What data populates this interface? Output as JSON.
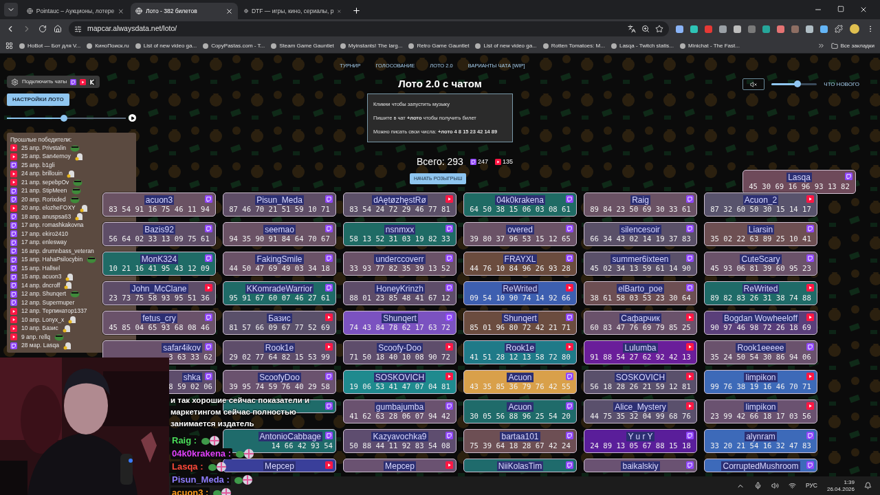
{
  "browser": {
    "tabs": [
      {
        "title": "Pointauc – Аукционы, лотере",
        "selected": false
      },
      {
        "title": "Лото - 382 билетов",
        "selected": true
      },
      {
        "title": "DTF — игры, кино, сериалы, р",
        "selected": false
      }
    ],
    "address": "mapcar.alwaysdata.net/loto/",
    "bookmarks": [
      "HoBot — Бот для V...",
      "КиноПоиск.ru",
      "List of new video ga...",
      "CopyPastas.com - T...",
      "Steam Game Gauntlet",
      "Myinstants! The larg...",
      "Retro Game Gauntlet",
      "List of new video ga...",
      "Rotten Tomatoes: M...",
      "Lasqa - Twitch statis...",
      "Minichat - The Fast..."
    ],
    "all_bookmarks": "Все закладки"
  },
  "nav": [
    "ТУРНИР",
    "ГОЛОСОВАНИЕ",
    "ЛОТО 2.0",
    "ВАРИАНТЫ ЧАТА [WIP]"
  ],
  "title": "Лото 2.0 с чатом",
  "connect_chats": "Подключить чаты",
  "settings_button": "НАСТРОЙКИ ЛОТО",
  "music_slider": {
    "level": 0.48
  },
  "volume": {
    "level": 0.57
  },
  "whats_new": "ЧТО НОВОГО",
  "info": [
    "Кликни чтобы запустить музыку",
    "Пишите в чат **+лото** чтобы получить билет",
    "Можно писать свои числа: **+лото 4 8 15 23 42 14 89**"
  ],
  "total": {
    "label": "Всего: 293",
    "twitch": "247",
    "youtube": "135"
  },
  "start_button": "НАЧАТЬ РОЗЫГРЫШ",
  "winners": {
    "title": "Прошлые победители:",
    "items": [
      {
        "text": "25 апр. Privstalin",
        "kind": "youtube",
        "emotes": [
          {
            "kind": "frog"
          }
        ]
      },
      {
        "text": "25 апр. San4ernoy",
        "kind": "youtube",
        "emotes": [
          {
            "kind": "ghost"
          }
        ]
      },
      {
        "text": "25 апр. b1gli",
        "kind": "twitch"
      },
      {
        "text": "24 апр. brillouin",
        "kind": "youtube",
        "emotes": [
          {
            "kind": "ghost"
          }
        ]
      },
      {
        "text": "21 апр. sepebpOv",
        "kind": "youtube",
        "emotes": [
          {
            "kind": "frog"
          }
        ]
      },
      {
        "text": "21 апр. StipMeen",
        "kind": "twitch",
        "emotes": [
          {
            "kind": "frog"
          }
        ]
      },
      {
        "text": "20 апр. Rorixded",
        "kind": "twitch",
        "emotes": [
          {
            "kind": "frog"
          }
        ]
      },
      {
        "text": "20 апр. elozheFOXY",
        "kind": "youtube",
        "emotes": [
          {
            "kind": "ghost"
          }
        ]
      },
      {
        "text": "18 апр. anuspsa63",
        "kind": "twitch",
        "emotes": [
          {
            "kind": "ghost"
          }
        ]
      },
      {
        "text": "17 апр. romashkakovna",
        "kind": "twitch"
      },
      {
        "text": "17 апр. ekiro2410",
        "kind": "twitch"
      },
      {
        "text": "17 апр. enlesway",
        "kind": "twitch"
      },
      {
        "text": "16 апр. drumnbass_veteran",
        "kind": "twitch"
      },
      {
        "text": "15 апр. HahaPsilocybin",
        "kind": "twitch",
        "emotes": [
          {
            "kind": "frog"
          }
        ]
      },
      {
        "text": "15 апр. Hallsel",
        "kind": "twitch"
      },
      {
        "text": "15 апр. acuon3",
        "kind": "twitch",
        "emotes": [
          {
            "kind": "ghost"
          }
        ]
      },
      {
        "text": "14 апр. dncroff",
        "kind": "twitch",
        "emotes": [
          {
            "kind": "ghost"
          }
        ]
      },
      {
        "text": "12 апр. Shunqert",
        "kind": "twitch",
        "emotes": [
          {
            "kind": "frog"
          }
        ]
      },
      {
        "text": "12 апр. Supermuper",
        "kind": "twitch"
      },
      {
        "text": "12 апр. Терпинатор1337",
        "kind": "youtube"
      },
      {
        "text": "10 апр. Lonyx_x",
        "kind": "youtube",
        "emotes": [
          {
            "kind": "ghost"
          }
        ]
      },
      {
        "text": "10 апр. Базис",
        "kind": "youtube",
        "emotes": [
          {
            "kind": "ghost"
          }
        ]
      },
      {
        "text": "9 апр. rellq",
        "kind": "youtube",
        "emotes": [
          {
            "kind": "frog"
          }
        ]
      },
      {
        "text": "28 мар. Lasqa",
        "kind": "twitch",
        "emotes": [
          {
            "kind": "ghost"
          }
        ]
      }
    ]
  },
  "floating_ticket": {
    "name": "Lasqa",
    "numbers": "45 30 69 16 96 93 13 82",
    "kind": "twitch",
    "color": "#6e4a5a"
  },
  "tickets": [
    [
      {
        "name": "acuon3",
        "numbers": "83 54 91 16 75 46 11 94",
        "kind": "twitch",
        "color": "#6a5263"
      },
      {
        "name": "Pisun_Meda",
        "numbers": "87 46 70 21 51 59 10 71",
        "kind": "twitch",
        "color": "#5e4d66"
      },
      {
        "name": "dAętøzhęstRø",
        "numbers": "83 54 24 72 29 46 77 81",
        "kind": "youtube",
        "color": "#5c5068"
      },
      {
        "name": "04k0krakena",
        "numbers": "64 50 38 15 06 03 08 61",
        "kind": "twitch",
        "color": "#1f6b64"
      },
      {
        "name": "Raig",
        "numbers": "89 84 23 50 69 30 33 61",
        "kind": "twitch",
        "color": "#6a5264"
      },
      {
        "name": "Acuon_2",
        "numbers": "87 32 60 50 30 15 14 17",
        "kind": "youtube",
        "color": "#58536c"
      }
    ],
    [
      {
        "name": "Bazis92",
        "numbers": "56 64 02 33 13 09 75 61",
        "kind": "twitch",
        "color": "#5e4d67"
      },
      {
        "name": "seemao",
        "numbers": "94 35 90 91 84 64 70 67",
        "kind": "twitch",
        "color": "#6a5265"
      },
      {
        "name": "nsnmxx",
        "numbers": "58 13 52 31 03 19 82 33",
        "kind": "twitch",
        "color": "#1f6b65"
      },
      {
        "name": "overed",
        "numbers": "39 80 37 96 53 15 12 65",
        "kind": "twitch",
        "color": "#6a5266"
      },
      {
        "name": "silencesoir",
        "numbers": "66 34 43 02 14 19 37 83",
        "kind": "twitch",
        "color": "#5a5068"
      },
      {
        "name": "Liarsin",
        "numbers": "35 02 22 63 89 25 10 41",
        "kind": "twitch",
        "color": "#6d4f52"
      }
    ],
    [
      {
        "name": "MonK324",
        "numbers": "10 21 16 41 95 43 12 09",
        "kind": "twitch",
        "color": "#1f6b66"
      },
      {
        "name": "FakingSmile",
        "numbers": "44 50 47 69 49 03 34 18",
        "kind": "twitch",
        "color": "#6a5267"
      },
      {
        "name": "underccoverr",
        "numbers": "33 93 77 82 35 39 13 52",
        "kind": "twitch",
        "color": "#6a5268"
      },
      {
        "name": "FRAYXL",
        "numbers": "44 76 10 84 96 26 93 28",
        "kind": "twitch",
        "color": "#6b4c3e"
      },
      {
        "name": "summer6ixteen",
        "numbers": "45 02 34 13 59 61 14 90",
        "kind": "twitch",
        "color": "#5a5069"
      },
      {
        "name": "CuteScary",
        "numbers": "45 93 06 81 39 60 95 23",
        "kind": "twitch",
        "color": "#6a5269"
      }
    ],
    [
      {
        "name": "John_McClane",
        "numbers": "23 73 75 58 93 95 51 36",
        "kind": "youtube",
        "color": "#5e4d68"
      },
      {
        "name": "KKomradeWarrior",
        "numbers": "95 91 67 60 07 46 27 61",
        "kind": "twitch",
        "color": "#1f6b67"
      },
      {
        "name": "HoneyKrinzh",
        "numbers": "88 01 23 85 48 41 67 12",
        "kind": "twitch",
        "color": "#5e4d69"
      },
      {
        "name": "ReWrited",
        "numbers": "09 54 10 90 74 14 92 66",
        "kind": "youtube",
        "color": "#3d5fb0"
      },
      {
        "name": "elBarto_poe",
        "numbers": "38 61 58 03 53 23 30 64",
        "kind": "twitch",
        "color": "#6d4f53"
      },
      {
        "name": "ReWrited",
        "numbers": "89 82 83 26 31 38 74 88",
        "kind": "youtube",
        "color": "#1f6b68"
      }
    ],
    [
      {
        "name": "fetus_cry",
        "numbers": "45 85 04 65 93 68 08 46",
        "kind": "twitch",
        "color": "#6a526a"
      },
      {
        "name": "Базис",
        "numbers": "81 57 66 09 67 77 52 69",
        "kind": "youtube",
        "color": "#5a506a"
      },
      {
        "name": "Shunqert",
        "numbers": "74 43 84 78 62 17 63 72",
        "kind": "twitch",
        "color": "#7b52c0"
      },
      {
        "name": "Shunqert",
        "numbers": "85 01 96 80 72 42 21 71",
        "kind": "twitch",
        "color": "#6b4c3f"
      },
      {
        "name": "Сафарчик",
        "numbers": "60 83 47 76 69 79 85 25",
        "kind": "youtube",
        "color": "#6a526b"
      },
      {
        "name": "Bogdan Wowheeloff",
        "numbers": "90 97 46 98 72 26 18 69",
        "kind": "youtube",
        "color": "#5a3f7a"
      }
    ],
    [
      {
        "name": "safar4ikov",
        "numbers": "3 63 33 62",
        "kind": "twitch",
        "color": "#6a526c",
        "covered": true
      },
      {
        "name": "Rook1e",
        "numbers": "29 02 77 64 82 15 53 99",
        "kind": "youtube",
        "color": "#5e4d6a"
      },
      {
        "name": "Scoofy-Doo",
        "numbers": "71 50 18 40 10 08 90 72",
        "kind": "youtube",
        "color": "#5e4d6b"
      },
      {
        "name": "Rook1e",
        "numbers": "41 51 28 12 13 58 72 80",
        "kind": "youtube",
        "color": "#1f7a88"
      },
      {
        "name": "Lulumba",
        "numbers": "91 88 54 27 62 92 42 13",
        "kind": "youtube",
        "color": "#6a1e9a"
      },
      {
        "name": "Rook1eeeee",
        "numbers": "35 24 50 54 30 86 94 06",
        "kind": "twitch",
        "color": "#6a526d"
      }
    ],
    [
      {
        "name": "shka",
        "numbers": "8 59 02 06",
        "kind": "twitch",
        "color": "#5e4d6c",
        "covered": true
      },
      {
        "name": "ScoofyDoo",
        "numbers": "39 95 74 59 76 40 29 58",
        "kind": "twitch",
        "color": "#6a526e"
      },
      {
        "name": "SOSKOVICH",
        "numbers": "19 06 53 41 47 07 04 81",
        "kind": "youtube",
        "color": "#1f8a8e"
      },
      {
        "name": "Acuon",
        "numbers": "43 35 85 36 79 76 42 55",
        "kind": "twitch",
        "color": "#d9a04a"
      },
      {
        "name": "SOSKOVICH",
        "numbers": "56 18 28 26 21 59 12 81",
        "kind": "youtube",
        "color": "#5a506b"
      },
      {
        "name": "limpikon",
        "numbers": "99 76 38 19 16 46 70 71",
        "kind": "youtube",
        "color": "#3d6ab8"
      }
    ],
    [
      {
        "kind": "twitch",
        "color": "#1f6b69"
      },
      {
        "name": "gumbajumba",
        "numbers": "41 62 63 28 06 07 94 42",
        "kind": "twitch",
        "color": "#6a526f"
      },
      {
        "name": "Acuon",
        "numbers": "30 05 56 88 96 25 54 20",
        "kind": "twitch",
        "color": "#1f6b6a"
      },
      {
        "name": "Alice_Mystery",
        "numbers": "44 75 35 32 04 99 68 76",
        "kind": "youtube",
        "color": "#5a506c"
      },
      {
        "name": "limpikon",
        "numbers": "23 99 42 66 18 17 03 56",
        "kind": "youtube",
        "color": "#6a5270"
      }
    ],
    [
      {
        "name": "AntonioCabbage",
        "numbers": "14 66 42 93 54",
        "kind": "twitch",
        "color": "#1f6b6b",
        "covered": true
      },
      {
        "name": "Kazyavochka9",
        "numbers": "50 88 44 11 92 83 54 08",
        "kind": "twitch",
        "color": "#5e4d6f"
      },
      {
        "name": "bartaa101",
        "numbers": "75 39 64 18 28 67 42 24",
        "kind": "twitch",
        "color": "#6d4f54"
      },
      {
        "name": "Y u r Y",
        "numbers": "24 89 13 05 67 88 15 18",
        "kind": "twitch",
        "color": "#5a1e9a"
      },
      {
        "name": "alynram",
        "numbers": "33 20 21 54 16 32 47 83",
        "kind": "twitch",
        "color": "#3d6ab9"
      }
    ],
    [
      {
        "name": "Мерсер",
        "kind": "youtube",
        "color": "#3a3f9a"
      },
      {
        "name": "Мерсер",
        "kind": "youtube",
        "color": "#6a5271"
      },
      {
        "name": "NiiKolasTim",
        "kind": "twitch",
        "color": "#1f6b6c"
      },
      {
        "name": "baikalskiy",
        "kind": "twitch",
        "color": "#6a5272"
      },
      {
        "name": "CorruptedMushroom",
        "kind": "twitch",
        "color": "#3d6aba"
      }
    ]
  ],
  "stream_overlay": {
    "caption": [
      "и так хорошие сейчас показатели и",
      "маркетингом сейчас полностью",
      "занимается издатель"
    ],
    "chat": [
      {
        "text": "Raig :",
        "color": "#4ade5a"
      },
      {
        "text": "04k0krakena :",
        "color": "#e040fb"
      },
      {
        "text": "Lasqa :",
        "color": "#ff4a3a"
      },
      {
        "text": "Pisun_Meda :",
        "color": "#8f7dff"
      },
      {
        "text": "acuon3 :",
        "color": "#ff9a1a"
      }
    ]
  },
  "taskbar": {
    "language": "РУС",
    "time": "1:39",
    "date": "26.04.2026"
  }
}
